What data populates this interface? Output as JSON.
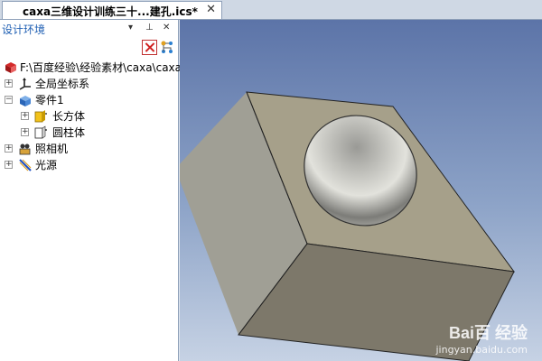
{
  "tab": {
    "title": "caxa三维设计训练三十...建孔.ics*",
    "close": "✕"
  },
  "panel": {
    "title": "设计环境",
    "header_buttons": [
      "▾",
      "⊥",
      "✕"
    ]
  },
  "tree": {
    "root": {
      "label": "F:\\百度经验\\经验素材\\caxa\\caxa"
    },
    "items": [
      {
        "label": "全局坐标系",
        "icon": "axes-icon",
        "level": 1
      },
      {
        "label": "零件1",
        "icon": "part-icon",
        "level": 1
      },
      {
        "label": "长方体",
        "icon": "box-icon",
        "level": 2
      },
      {
        "label": "圆柱体",
        "icon": "cylinder-icon",
        "level": 2
      },
      {
        "label": "照相机",
        "icon": "camera-icon",
        "level": 1
      },
      {
        "label": "光源",
        "icon": "light-icon",
        "level": 1
      }
    ]
  },
  "watermark": {
    "logo": "Bai百 经验",
    "url": "jingyan.baidu.com"
  }
}
